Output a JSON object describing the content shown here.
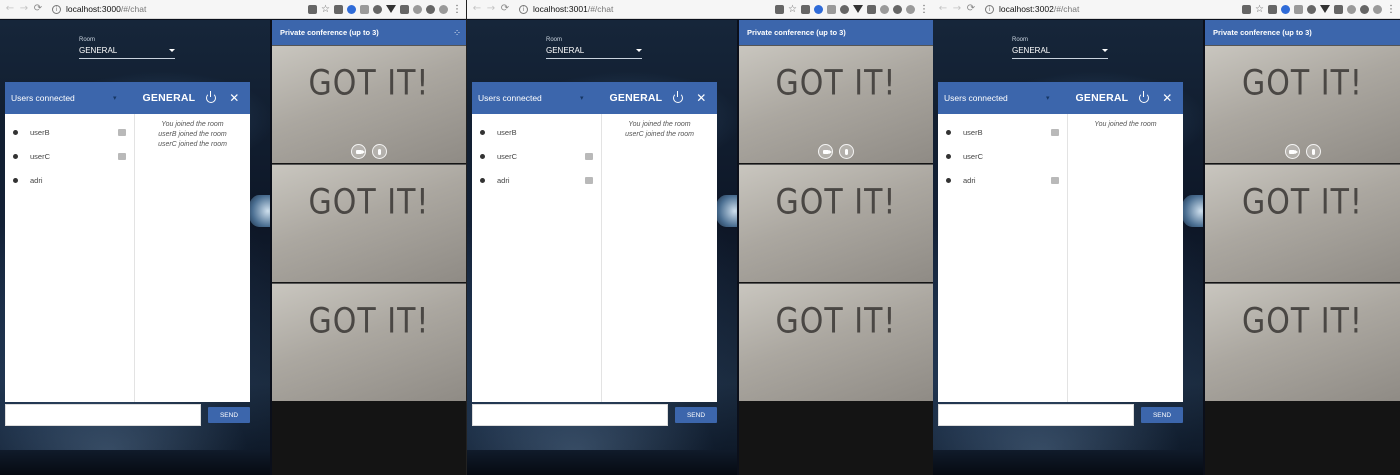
{
  "windows": [
    {
      "url_host": "localhost:3000",
      "url_path": "/#/chat",
      "room_label": "Room",
      "room_value": "GENERAL",
      "users_title": "Users connected",
      "room_title": "GENERAL",
      "users": [
        {
          "name": "userB",
          "has_chat_icon": true
        },
        {
          "name": "userC",
          "has_chat_icon": true
        },
        {
          "name": "adri",
          "has_chat_icon": false
        }
      ],
      "messages": [
        "You joined the room",
        "userB joined the room",
        "userC joined the room"
      ],
      "input_value": "",
      "send_label": "SEND",
      "conference_title": "Private conference (up to 3)",
      "video_text": "GOT IT!"
    },
    {
      "url_host": "localhost:3001",
      "url_path": "/#/chat",
      "room_label": "Room",
      "room_value": "GENERAL",
      "users_title": "Users connected",
      "room_title": "GENERAL",
      "users": [
        {
          "name": "userB",
          "has_chat_icon": false
        },
        {
          "name": "userC",
          "has_chat_icon": true
        },
        {
          "name": "adri",
          "has_chat_icon": true
        }
      ],
      "messages": [
        "You joined the room",
        "userC joined the room"
      ],
      "input_value": "",
      "send_label": "SEND",
      "conference_title": "Private conference (up to 3)",
      "video_text": "GOT IT!"
    },
    {
      "url_host": "localhost:3002",
      "url_path": "/#/chat",
      "room_label": "Room",
      "room_value": "GENERAL",
      "users_title": "Users connected",
      "room_title": "GENERAL",
      "users": [
        {
          "name": "userB",
          "has_chat_icon": true
        },
        {
          "name": "userC",
          "has_chat_icon": false
        },
        {
          "name": "adri",
          "has_chat_icon": true
        }
      ],
      "messages": [
        "You joined the room"
      ],
      "input_value": "",
      "send_label": "SEND",
      "conference_title": "Private conference (up to 3)",
      "video_text": "GOT IT!"
    }
  ],
  "colors": {
    "accent": "#3c66ac",
    "chat_bg": "#ffffff"
  }
}
